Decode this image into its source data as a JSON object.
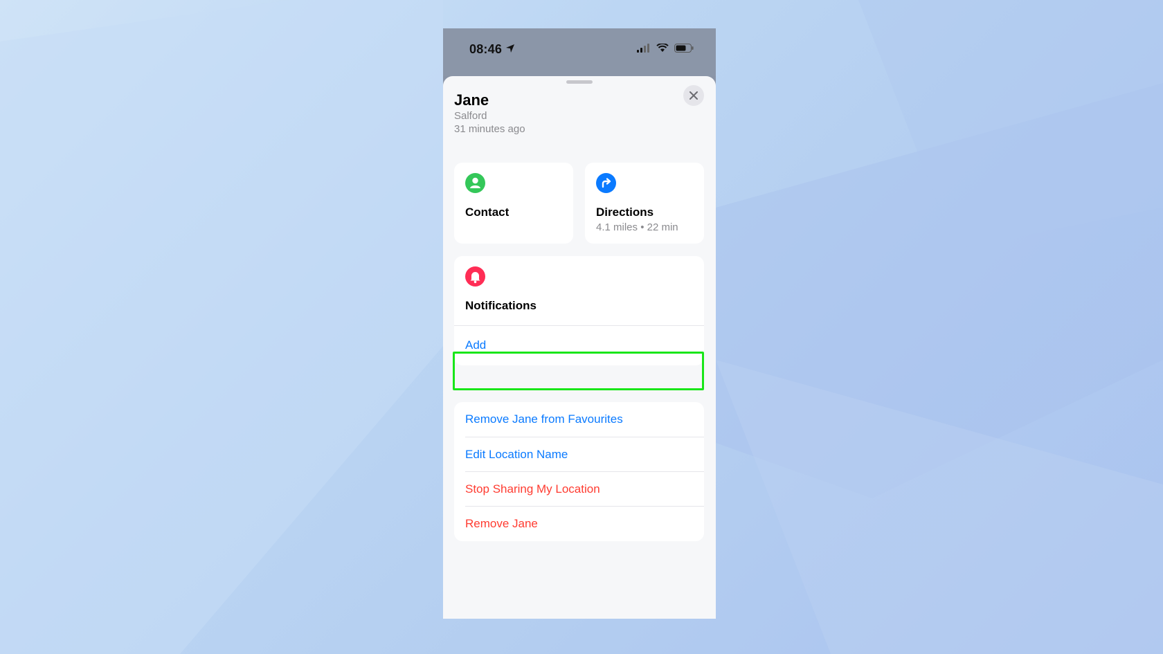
{
  "status_bar": {
    "time": "08:46",
    "icons": [
      "location-arrow-icon",
      "signal-icon",
      "wifi-icon",
      "battery-icon"
    ]
  },
  "person": {
    "name": "Jane",
    "location": "Salford",
    "last_seen": "31 minutes ago"
  },
  "cards": {
    "contact": {
      "label": "Contact",
      "icon": "person-icon",
      "color": "#34c759"
    },
    "directions": {
      "label": "Directions",
      "detail": "4.1 miles • 22 min",
      "icon": "directions-arrow-icon",
      "color": "#0a7aff"
    }
  },
  "notifications": {
    "title": "Notifications",
    "icon": "bell-icon",
    "color": "#ff2d55",
    "add_label": "Add"
  },
  "actions": [
    {
      "label": "Remove Jane from Favourites",
      "color": "#0a7aff"
    },
    {
      "label": "Edit Location Name",
      "color": "#0a7aff"
    },
    {
      "label": "Stop Sharing My Location",
      "color": "#ff3b30"
    },
    {
      "label": "Remove Jane",
      "color": "#ff3b30"
    }
  ],
  "colors": {
    "highlight": "#19e619",
    "link_blue": "#0a7aff",
    "destructive_red": "#ff3b30"
  }
}
